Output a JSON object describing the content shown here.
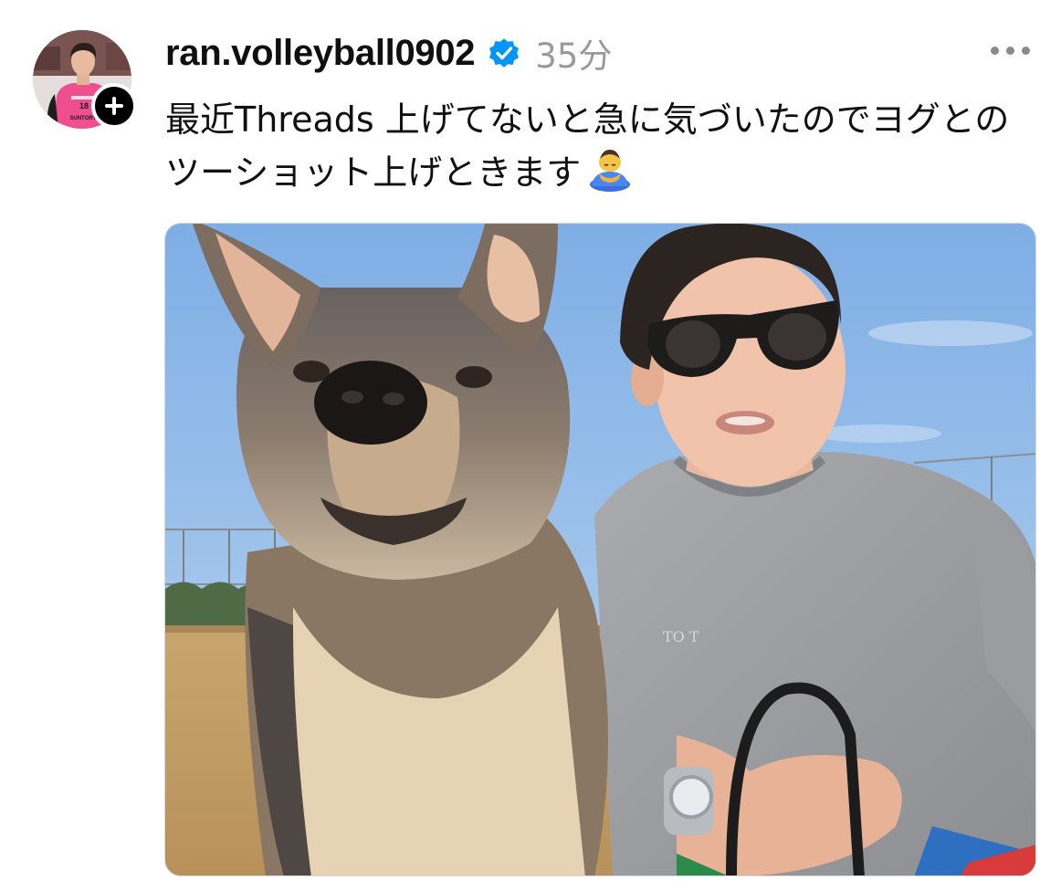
{
  "post": {
    "username": "ran.volleyball0902",
    "verified": true,
    "timestamp": "35分",
    "caption_lines": [
      "最近Threads 上げてないと急に気づいたのでヨグとの",
      "ツーショット上げときます"
    ],
    "caption_emoji": "person-bowing-emoji"
  },
  "avatar": {
    "icon": "profile-avatar",
    "jersey_number": "18",
    "jersey_text": "SUNTORY"
  },
  "follow_button": {
    "icon": "plus-icon"
  },
  "more_button": {
    "icon": "more-horizontal-icon"
  },
  "verified_badge": {
    "icon": "verified-badge-icon",
    "color": "#0095f6"
  },
  "photo": {
    "description_icon": "post-photo",
    "sweatshirt_text": "TO  T"
  },
  "colors": {
    "text": "#101010",
    "secondary": "#999999",
    "accent": "#0095f6",
    "sky": "#8fb8e6",
    "ground": "#c9a46a"
  }
}
